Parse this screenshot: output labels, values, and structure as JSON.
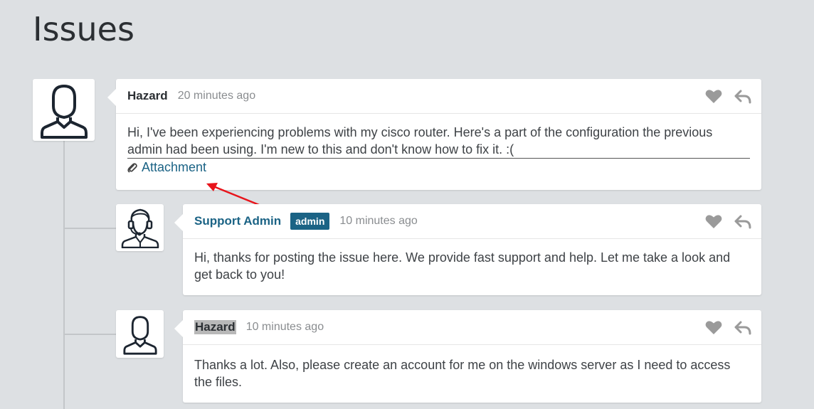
{
  "page": {
    "title": "Issues"
  },
  "colors": {
    "accent": "#1b6385",
    "background": "#dde0e3",
    "annotation_arrow": "#e8141b"
  },
  "posts": [
    {
      "author": "Hazard",
      "time": "20 minutes ago",
      "body": "Hi, I've been experiencing problems with my cisco router. Here's a part of the configuration the previous admin had been using. I'm new to this and don't know how to fix it. :(",
      "attachment_label": "Attachment",
      "avatar_icon": "user-outline-icon"
    },
    {
      "author": "Support Admin",
      "badge": "admin",
      "time": "10 minutes ago",
      "body": "Hi, thanks for posting the issue here. We provide fast support and help. Let me take a look and get back to you!",
      "avatar_icon": "support-agent-headset-icon"
    },
    {
      "author": "Hazard",
      "time": "10 minutes ago",
      "body": "Thanks a lot. Also, please create an account for me on the windows server as I need to access the files.",
      "avatar_icon": "user-outline-icon"
    }
  ],
  "actions": {
    "like_icon": "heart-icon",
    "reply_icon": "reply-icon"
  }
}
